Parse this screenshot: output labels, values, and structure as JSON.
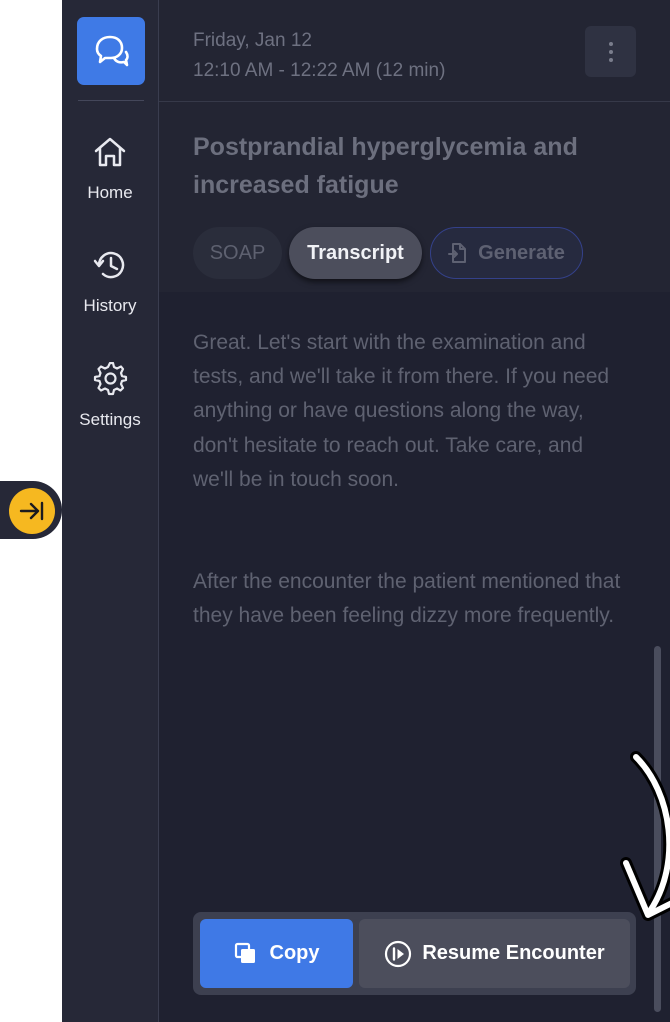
{
  "sidebar": {
    "logo_icon": "chat-bubbles-icon",
    "items": [
      {
        "label": "Home",
        "icon": "home-icon"
      },
      {
        "label": "History",
        "icon": "history-icon"
      },
      {
        "label": "Settings",
        "icon": "gear-icon"
      }
    ],
    "toggle_icon": "collapse-sidebar-icon"
  },
  "header": {
    "date": "Friday, Jan 12",
    "time_range": "12:10 AM - 12:22 AM (12 min)",
    "menu_icon": "more-vertical-icon"
  },
  "encounter": {
    "title": "Postprandial hyperglycemia and increased fatigue"
  },
  "tabs": [
    {
      "label": "SOAP",
      "active": false
    },
    {
      "label": "Transcript",
      "active": true
    },
    {
      "label": "Generate",
      "active": false,
      "icon": "generate-document-icon"
    }
  ],
  "transcript": {
    "paragraphs": [
      "Great. Let's start with the examination and tests, and we'll take it from there. If you need anything or have questions along the way, don't hesitate to reach out. Take care, and we'll be in touch soon.",
      "After the encounter the patient mentioned that they have been feeling dizzy more frequently."
    ]
  },
  "actions": {
    "copy_label": "Copy",
    "copy_icon": "copy-icon",
    "resume_label": "Resume Encounter",
    "resume_icon": "resume-icon"
  },
  "colors": {
    "accent": "#3f7ae6",
    "toggle": "#f6b820",
    "sidebar_bg": "#262837",
    "main_bg": "#232533"
  }
}
